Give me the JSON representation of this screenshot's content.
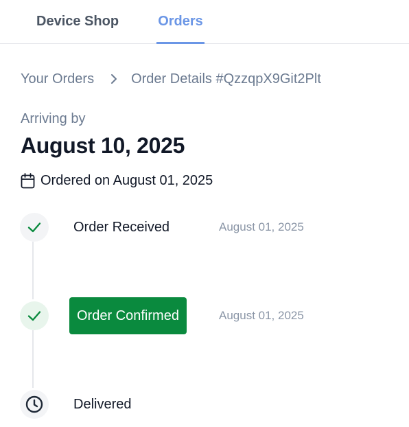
{
  "nav": {
    "brand": "Device Shop",
    "orders": "Orders"
  },
  "breadcrumb": {
    "parent": "Your Orders",
    "current": "Order Details #QzzqpX9Git2Plt"
  },
  "arrival": {
    "label": "Arriving by",
    "date": "August 10, 2025"
  },
  "ordered_on": {
    "icon": "calendar-icon",
    "text": "Ordered on August 01, 2025"
  },
  "timeline": [
    {
      "label": "Order Received",
      "date": "August 01, 2025",
      "status": "done",
      "icon": "check-icon"
    },
    {
      "label": "Order Confirmed",
      "date": "August 01, 2025",
      "status": "current",
      "icon": "check-icon"
    },
    {
      "label": "Delivered",
      "date": "",
      "status": "pending",
      "icon": "clock-icon"
    }
  ],
  "colors": {
    "accent": "#6b96e6",
    "success": "#0a8a3e",
    "muted": "#6b7a90"
  }
}
